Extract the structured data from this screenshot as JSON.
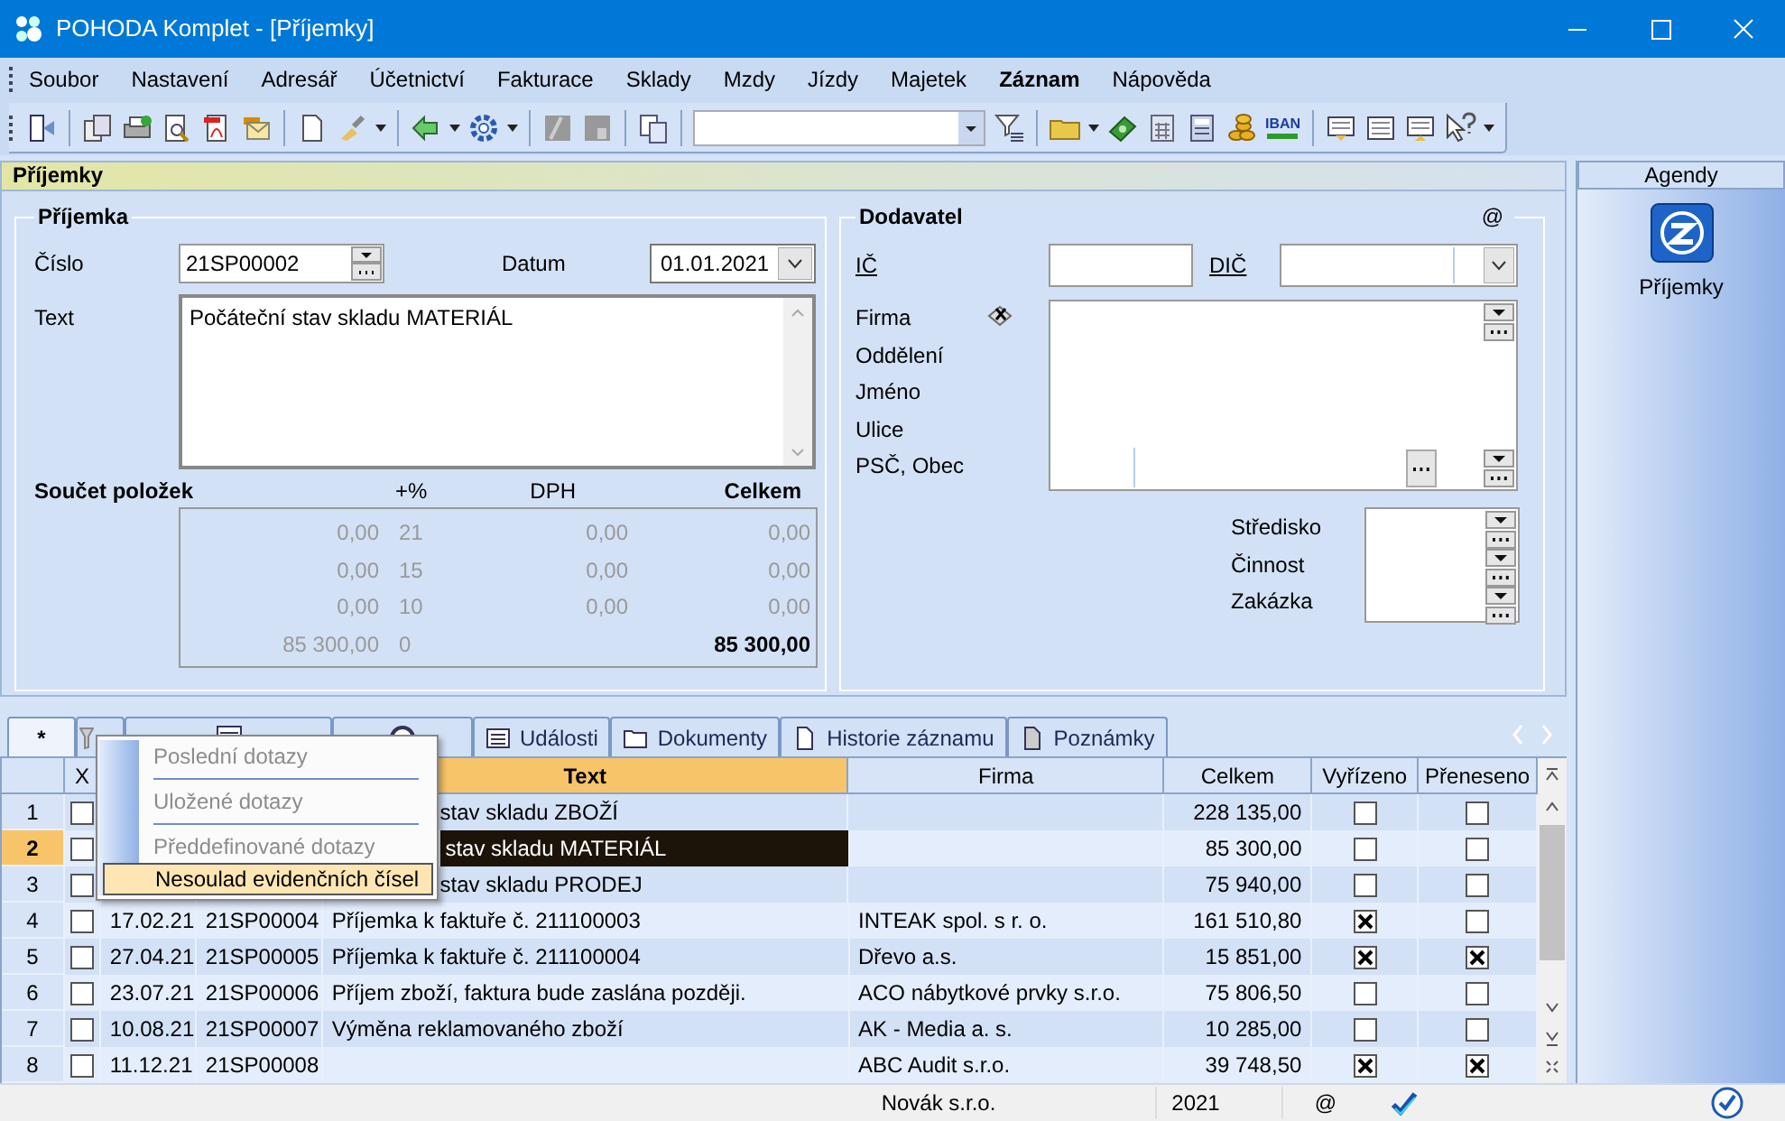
{
  "window": {
    "title": "POHODA Komplet - [Příjemky]"
  },
  "menu_bar": [
    {
      "label": "Soubor",
      "bold": false
    },
    {
      "label": "Nastavení",
      "bold": false
    },
    {
      "label": "Adresář",
      "bold": false
    },
    {
      "label": "Účetnictví",
      "bold": false
    },
    {
      "label": "Fakturace",
      "bold": false
    },
    {
      "label": "Sklady",
      "bold": false
    },
    {
      "label": "Mzdy",
      "bold": false
    },
    {
      "label": "Jízdy",
      "bold": false
    },
    {
      "label": "Majetek",
      "bold": false
    },
    {
      "label": "Záznam",
      "bold": true
    },
    {
      "label": "Nápověda",
      "bold": false
    }
  ],
  "toolbar": {
    "iban_label": "IBAN"
  },
  "section_title": "Příjemky",
  "receipt": {
    "title": "Příjemka",
    "number_label": "Číslo",
    "number": "21SP00002",
    "date_label": "Datum",
    "date": "01.01.2021",
    "text_label": "Text",
    "text": "Počáteční stav skladu MATERIÁL",
    "totals": {
      "title": "Součet položek",
      "headers": [
        "+%",
        "DPH",
        "Celkem"
      ],
      "rows": [
        {
          "base": "0,00",
          "rate": "21",
          "vat": "0,00",
          "total": "0,00",
          "bold": false
        },
        {
          "base": "0,00",
          "rate": "15",
          "vat": "0,00",
          "total": "0,00",
          "bold": false
        },
        {
          "base": "0,00",
          "rate": "10",
          "vat": "0,00",
          "total": "0,00",
          "bold": false
        },
        {
          "base": "85 300,00",
          "rate": "0",
          "total": "85 300,00",
          "bold": true
        }
      ]
    }
  },
  "supplier": {
    "title": "Dodavatel",
    "at": "@",
    "ico_label": "IČ",
    "dic_label": "DIČ",
    "address_labels": [
      "Firma",
      "Oddělení",
      "Jméno",
      "Ulice",
      "PSČ, Obec"
    ],
    "center_labels": [
      "Středisko",
      "Činnost",
      "Zakázka"
    ]
  },
  "agenda": {
    "title": "Agendy",
    "items": [
      {
        "label": "Příjemky"
      }
    ]
  },
  "tabs": [
    {
      "label": "*",
      "selected": true
    },
    {
      "selected": false
    },
    {
      "selected": false
    },
    {
      "selected": false
    },
    {
      "label": "Události",
      "selected": false
    },
    {
      "label": "Dokumenty",
      "selected": false
    },
    {
      "label": "Historie záznamu",
      "selected": false
    },
    {
      "label": "Poznámky",
      "selected": false
    }
  ],
  "context_menu": {
    "items": [
      {
        "kind": "item",
        "label": "Poslední dotazy",
        "disabled": true,
        "selected": false
      },
      {
        "kind": "separator"
      },
      {
        "kind": "item",
        "label": "Uložené dotazy",
        "disabled": true,
        "selected": false
      },
      {
        "kind": "separator"
      },
      {
        "kind": "item",
        "label": "Předdefinované dotazy",
        "disabled": true,
        "selected": false
      },
      {
        "kind": "item",
        "label": "Nesoulad evidenčních čísel",
        "disabled": false,
        "selected": true
      }
    ]
  },
  "grid": {
    "columns": [
      {
        "label": "X",
        "sorted": false
      },
      {
        "label": "Text",
        "sorted": true
      },
      {
        "label": "Firma",
        "sorted": false
      },
      {
        "label": "Celkem",
        "sorted": false
      },
      {
        "label": "Vyřízeno",
        "sorted": false
      },
      {
        "label": "Přeneseno",
        "sorted": false
      }
    ],
    "rows": [
      {
        "number": "1",
        "selected": false,
        "marked": false,
        "text": "stav skladu ZBOŽÍ",
        "total": "228 135,00",
        "done": false,
        "transferred": false
      },
      {
        "number": "2",
        "selected": true,
        "marked": false,
        "text": "stav skladu MATERIÁL",
        "total": "85 300,00",
        "done": false,
        "transferred": false
      },
      {
        "number": "3",
        "selected": false,
        "marked": false,
        "text": "stav skladu PRODEJ",
        "total": "75 940,00",
        "done": false,
        "transferred": false
      },
      {
        "number": "4",
        "selected": false,
        "marked": false,
        "date": "17.02.21",
        "doc": "21SP00004",
        "text": "Příjemka k faktuře č. 211100003",
        "firm": "INTEAK spol. s r. o.",
        "total": "161 510,80",
        "done": true,
        "transferred": false
      },
      {
        "number": "5",
        "selected": false,
        "marked": false,
        "date": "27.04.21",
        "doc": "21SP00005",
        "text": "Příjemka k faktuře č. 211100004",
        "firm": "Dřevo a.s.",
        "total": "15 851,00",
        "done": true,
        "transferred": true
      },
      {
        "number": "6",
        "selected": false,
        "marked": false,
        "date": "23.07.21",
        "doc": "21SP00006",
        "text": "Příjem zboží, faktura bude zaslána později.",
        "firm": "ACO nábytkové prvky s.r.o.",
        "total": "75 806,50",
        "done": false,
        "transferred": false
      },
      {
        "number": "7",
        "selected": false,
        "marked": false,
        "date": "10.08.21",
        "doc": "21SP00007",
        "text": "Výměna reklamovaného zboží",
        "firm": "AK - Media a. s.",
        "total": "10 285,00",
        "done": false,
        "transferred": false
      },
      {
        "number": "8",
        "selected": false,
        "marked": false,
        "date": "11.12.21",
        "doc": "21SP00008",
        "firm": "ABC Audit s.r.o.",
        "total": "39 748,50",
        "done": true,
        "transferred": true
      }
    ]
  },
  "status_bar": {
    "company": "Novák s.r.o.",
    "year": "2021",
    "at": "@"
  }
}
